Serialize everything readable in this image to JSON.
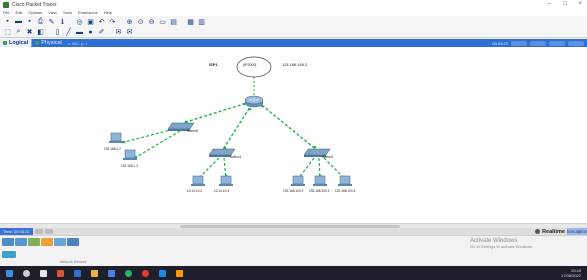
{
  "window": {
    "title": "Cisco Packet Tracer",
    "min": "–",
    "max": "□",
    "close": "×"
  },
  "menu": [
    "File",
    "Edit",
    "Options",
    "View",
    "Tools",
    "Extensions",
    "Help"
  ],
  "toolbar1": [
    "new",
    "open",
    "save",
    "print",
    "activity-wizard",
    "network-information",
    "zoom-fit",
    "copy",
    "undo",
    "redo",
    "zoom-in",
    "zoom-reset",
    "zoom-out",
    "rectangle",
    "palette",
    "custom-device",
    "pdu"
  ],
  "toolbar2": [
    "select",
    "inspect",
    "delete",
    "resize",
    "place-note",
    "draw-line",
    "draw-rectangle",
    "draw-ellipse",
    "freeform",
    "simple-pdu",
    "complex-pdu"
  ],
  "view": {
    "logical": "Logical",
    "physical": "Physical",
    "path": "x: 960, y: 1",
    "time": "00:03:22"
  },
  "network": {
    "cloud_label": "ISP1",
    "cloud_device": "{IP2000}",
    "ip_main": "115.166.166.2",
    "switches": [
      "Switch0",
      "Switch1",
      "Switch2"
    ],
    "pcs": [
      "192.168.1.2",
      "192.168.1.3",
      "10.10.10.2",
      "10.10.10.3",
      "192.168.100.2",
      "192.168.100.3",
      "192.168.100.4"
    ]
  },
  "status": {
    "time": "Time: 00:03:22",
    "realtime": "Realtime",
    "simulation": "Simulation"
  },
  "device_panel": {
    "device_name": "Network Devices"
  },
  "watermark": {
    "line1": "Activate Windows",
    "line2": "Go to Settings to activate Windows."
  },
  "taskbar": {
    "tray_time": "20:45",
    "tray_date": "17/06/2022"
  },
  "colors": {
    "link_green": "#19b44a",
    "view_bar": "#2d6fd4",
    "taskbar": "#1f1f2b"
  }
}
